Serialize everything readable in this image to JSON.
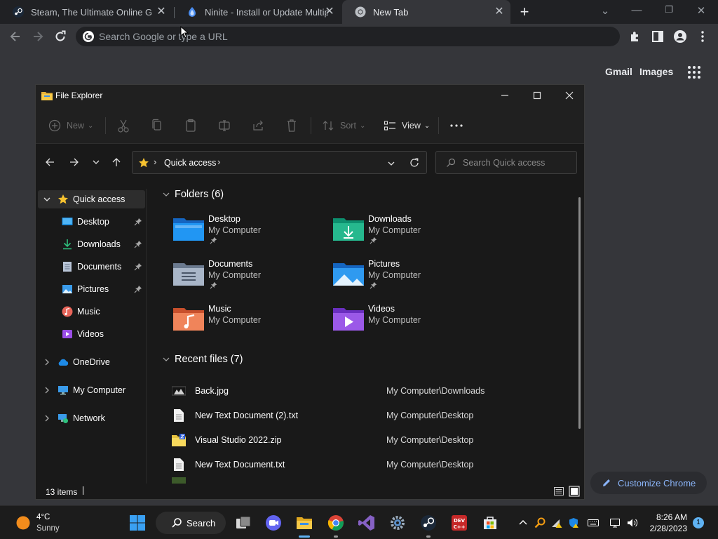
{
  "browser": {
    "tabs": [
      {
        "title": "Steam, The Ultimate Online Game Platform",
        "active": false
      },
      {
        "title": "Ninite - Install or Update Multiple Apps at Once",
        "active": false
      },
      {
        "title": "New Tab",
        "active": true
      }
    ],
    "omnibox_placeholder": "Search Google or type a URL",
    "ntp": {
      "gmail": "Gmail",
      "images": "Images",
      "customize": "Customize Chrome"
    }
  },
  "explorer": {
    "title": "File Explorer",
    "commands": {
      "new": "New",
      "sort": "Sort",
      "view": "View"
    },
    "address": "Quick access",
    "search_placeholder": "Search Quick access",
    "nav": [
      {
        "label": "Quick access",
        "pinned": false
      },
      {
        "label": "Desktop",
        "pinned": true
      },
      {
        "label": "Downloads",
        "pinned": true
      },
      {
        "label": "Documents",
        "pinned": true
      },
      {
        "label": "Pictures",
        "pinned": true
      },
      {
        "label": "Music",
        "pinned": false
      },
      {
        "label": "Videos",
        "pinned": false
      },
      {
        "label": "OneDrive",
        "pinned": false
      },
      {
        "label": "My Computer",
        "pinned": false
      },
      {
        "label": "Network",
        "pinned": false
      }
    ],
    "folders_header": "Folders (6)",
    "folders": [
      {
        "name": "Desktop",
        "location": "My Computer",
        "pinned": true
      },
      {
        "name": "Downloads",
        "location": "My Computer",
        "pinned": true
      },
      {
        "name": "Documents",
        "location": "My Computer",
        "pinned": true
      },
      {
        "name": "Pictures",
        "location": "My Computer",
        "pinned": true
      },
      {
        "name": "Music",
        "location": "My Computer",
        "pinned": false
      },
      {
        "name": "Videos",
        "location": "My Computer",
        "pinned": false
      }
    ],
    "recent_header": "Recent files (7)",
    "recent": [
      {
        "name": "Back.jpg",
        "path": "My Computer\\Downloads"
      },
      {
        "name": "New Text Document (2).txt",
        "path": "My Computer\\Desktop"
      },
      {
        "name": "Visual Studio 2022.zip",
        "path": "My Computer\\Desktop"
      },
      {
        "name": "New Text Document.txt",
        "path": "My Computer\\Desktop"
      }
    ],
    "status": "13 items"
  },
  "taskbar": {
    "weather_temp": "4°C",
    "weather_cond": "Sunny",
    "search": "Search",
    "time": "8:26 AM",
    "date": "2/28/2023",
    "notifications": "1",
    "colors": {
      "accent": "#5fb2f2"
    }
  }
}
